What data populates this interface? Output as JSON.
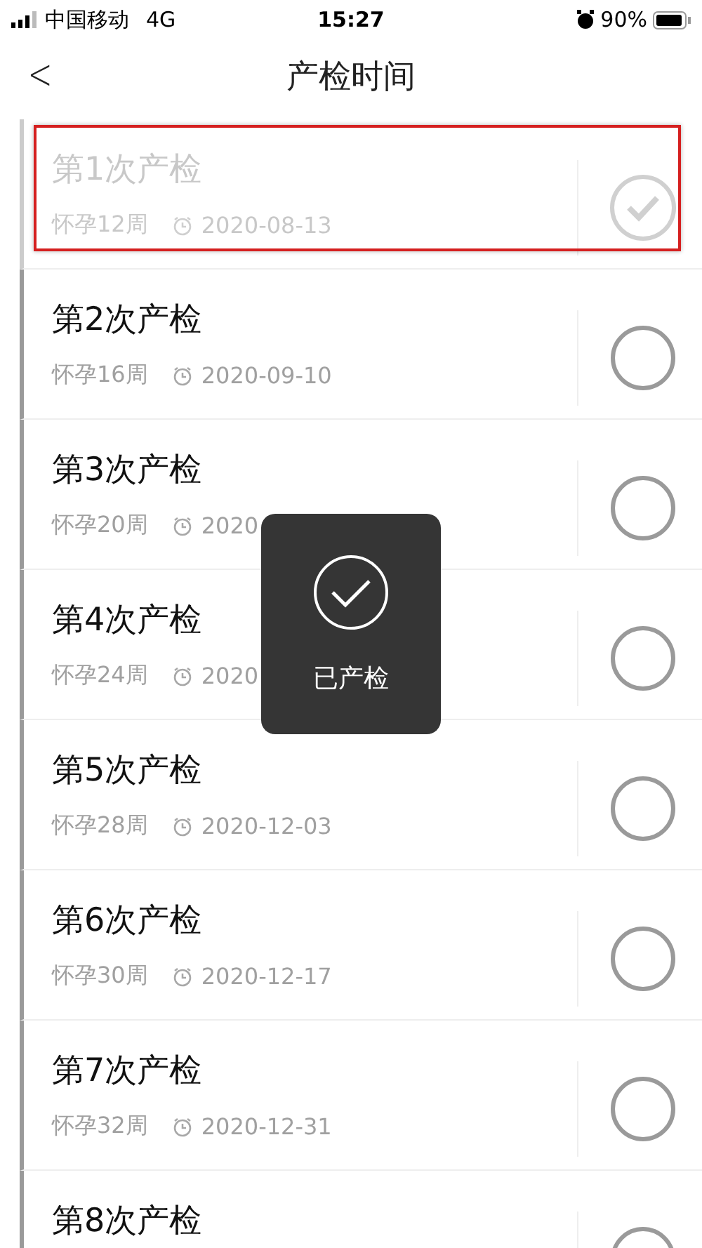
{
  "status_bar": {
    "carrier": "中国移动",
    "network": "4G",
    "time": "15:27",
    "battery": "90%"
  },
  "nav": {
    "back": "<",
    "title": "产检时间"
  },
  "visits": [
    {
      "title": "第1次产检",
      "week": "怀孕12周",
      "date": "2020-08-13",
      "done": true,
      "highlighted": true
    },
    {
      "title": "第2次产检",
      "week": "怀孕16周",
      "date": "2020-09-10",
      "done": false,
      "highlighted": false
    },
    {
      "title": "第3次产检",
      "week": "怀孕20周",
      "date": "2020",
      "done": false,
      "highlighted": false
    },
    {
      "title": "第4次产检",
      "week": "怀孕24周",
      "date": "2020",
      "done": false,
      "highlighted": false
    },
    {
      "title": "第5次产检",
      "week": "怀孕28周",
      "date": "2020-12-03",
      "done": false,
      "highlighted": false
    },
    {
      "title": "第6次产检",
      "week": "怀孕30周",
      "date": "2020-12-17",
      "done": false,
      "highlighted": false
    },
    {
      "title": "第7次产检",
      "week": "怀孕32周",
      "date": "2020-12-31",
      "done": false,
      "highlighted": false
    },
    {
      "title": "第8次产检",
      "done": false,
      "highlighted": false
    }
  ],
  "toast": {
    "message": "已产检"
  }
}
